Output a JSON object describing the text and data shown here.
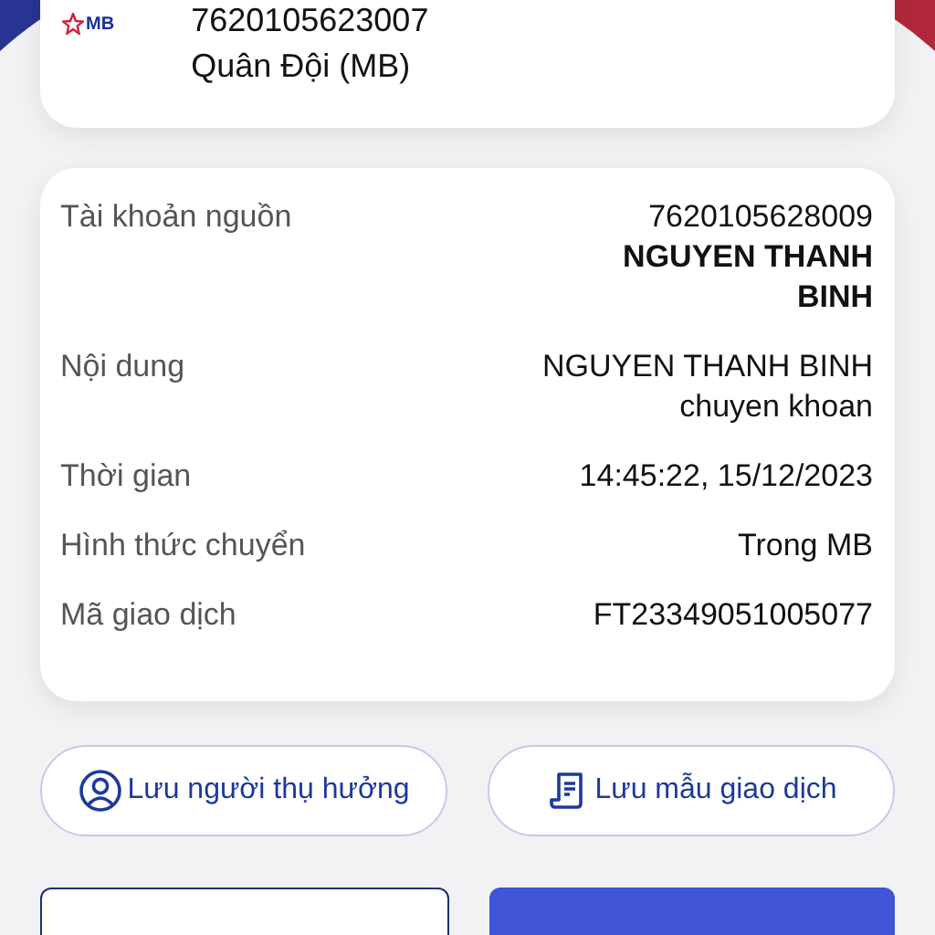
{
  "recipient": {
    "account_number": "7620105623007",
    "bank": "Quân Đội (MB)",
    "logo_text": "MB"
  },
  "details": [
    {
      "label": "Tài khoản nguồn",
      "values": [
        {
          "text": "7620105628009",
          "bold": false
        },
        {
          "text": "NGUYEN THANH BINH",
          "bold": true
        }
      ]
    },
    {
      "label": "Nội dung",
      "values": [
        {
          "text": "NGUYEN THANH BINH chuyen khoan",
          "bold": false
        }
      ]
    },
    {
      "label": "Thời gian",
      "values": [
        {
          "text": "14:45:22, 15/12/2023",
          "bold": false
        }
      ]
    },
    {
      "label": "Hình thức chuyển",
      "values": [
        {
          "text": "Trong MB",
          "bold": false
        }
      ]
    },
    {
      "label": "Mã giao dịch",
      "values": [
        {
          "text": "FT23349051005077",
          "bold": false
        }
      ]
    }
  ],
  "actions": [
    {
      "label": "Lưu người thụ hưởng",
      "kind": "person"
    },
    {
      "label": "Lưu mẫu giao dịch",
      "kind": "template"
    }
  ],
  "footer_buttons": [
    {
      "kind": "outline"
    },
    {
      "kind": "filled"
    }
  ]
}
